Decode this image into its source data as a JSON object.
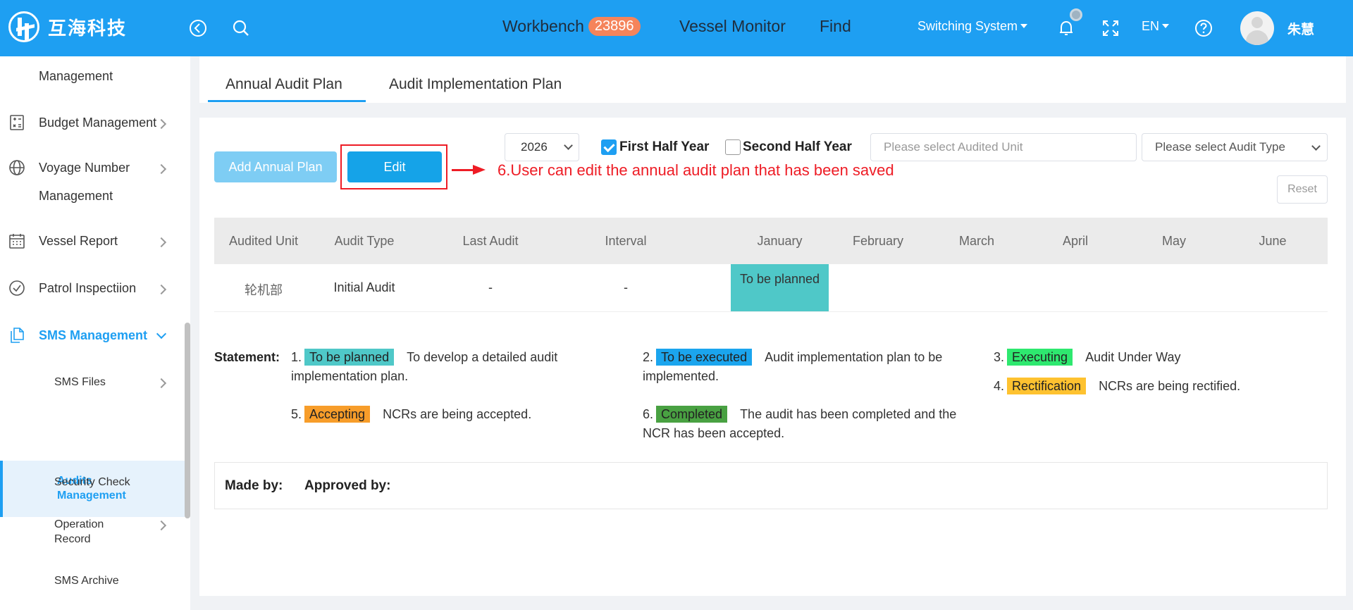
{
  "header": {
    "logo_text": "互海科技",
    "nav": {
      "workbench": "Workbench",
      "workbench_count": "23896",
      "vessel_monitor": "Vessel Monitor",
      "find": "Find"
    },
    "switching_system": "Switching System",
    "language": "EN",
    "user_name": "朱慧",
    "icons": [
      "back-icon",
      "search-icon",
      "bell-icon",
      "fullscreen-icon",
      "help-icon"
    ]
  },
  "sidebar": {
    "items": [
      {
        "label": "Management"
      },
      {
        "label": "Budget Management",
        "icon": "budget-icon"
      },
      {
        "label": "Voyage Number",
        "label2": "Management",
        "icon": "globe-icon"
      },
      {
        "label": "Vessel Report",
        "icon": "calendar-icon"
      },
      {
        "label": "Patrol Inspectiion",
        "icon": "check-circle-icon"
      },
      {
        "label": "SMS Management",
        "icon": "documents-icon"
      }
    ],
    "sub_items": [
      {
        "label": "SMS Files"
      },
      {
        "label": "Audits",
        "label2": "Management"
      },
      {
        "label": "Security Check"
      },
      {
        "label": "Operation",
        "label2": "Record"
      },
      {
        "label": "SMS Archive"
      }
    ]
  },
  "tabs": [
    "Annual Audit Plan",
    "Audit Implementation Plan"
  ],
  "toolbar": {
    "add_label": "Add Annual Plan",
    "edit_label": "Edit",
    "annotation": "6.User can edit the annual audit plan that has been saved",
    "year": "2026",
    "first_half": "First Half Year",
    "second_half": "Second Half Year",
    "first_half_checked": true,
    "second_half_checked": false,
    "unit_placeholder": "Please select Audited Unit",
    "type_placeholder": "Please select Audit Type",
    "reset_label": "Reset"
  },
  "table": {
    "columns": [
      "Audited Unit",
      "Audit Type",
      "Last Audit",
      "Interval",
      "January",
      "February",
      "March",
      "April",
      "May",
      "June"
    ],
    "rows": [
      {
        "audited_unit": "轮机部",
        "audit_type": "Initial Audit",
        "last_audit": "-",
        "interval": "-",
        "january": "To be planned"
      }
    ]
  },
  "statement": {
    "label": "Statement:",
    "entries": [
      {
        "num": "1.",
        "tag": "To be planned",
        "color": "#4fc8c8",
        "text": "To develop a detailed audit implementation plan."
      },
      {
        "num": "2.",
        "tag": "To be executed",
        "color": "#1ba5ee",
        "text": "Audit implementation plan to be implemented."
      },
      {
        "num": "3.",
        "tag": "Executing",
        "color": "#2ee86f",
        "text": "Audit Under Way"
      },
      {
        "num": "4.",
        "tag": "Rectification",
        "color": "#fec230",
        "text": "NCRs are being rectified."
      },
      {
        "num": "5.",
        "tag": "Accepting",
        "color": "#f79d2a",
        "text": "NCRs are being accepted."
      },
      {
        "num": "6.",
        "tag": "Completed",
        "color": "#49a142",
        "text": "The audit has been completed and the NCR has been accepted."
      }
    ]
  },
  "footer": {
    "made_by": "Made by:",
    "approved_by": "Approved by:"
  },
  "colors": {
    "primary": "#1e9ff2",
    "badge": "#f5845b",
    "annotation": "#ee1c25"
  }
}
